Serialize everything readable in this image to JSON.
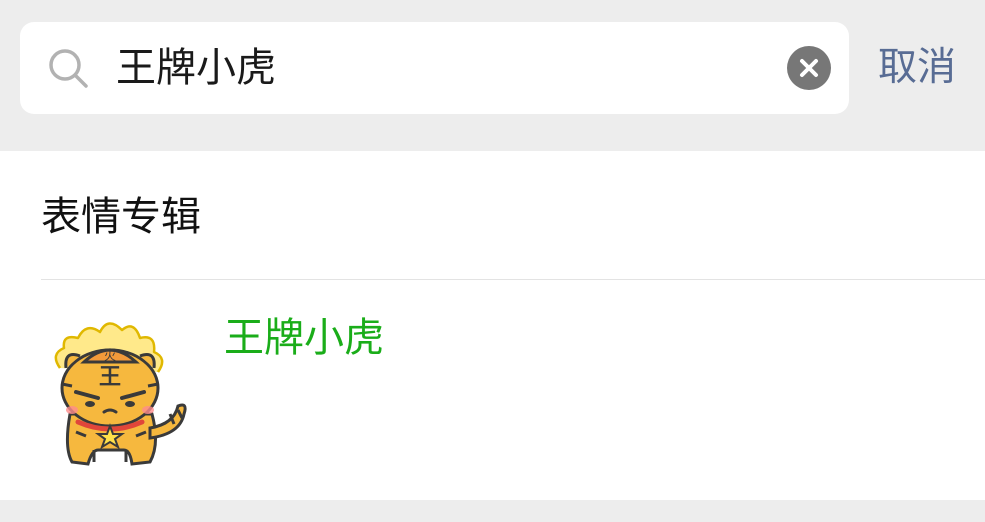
{
  "search": {
    "value": "王牌小虎",
    "cancel_label": "取消"
  },
  "icons": {
    "search": "search-icon",
    "clear": "close-icon",
    "sticker": "tiger-sticker-icon"
  },
  "results": {
    "section_title": "表情专辑",
    "items": [
      {
        "name": "王牌小虎",
        "thumb_glyph": "王"
      }
    ]
  },
  "colors": {
    "background": "#ededed",
    "highlight_green": "#1aad19",
    "cancel_blue": "#586c94"
  }
}
